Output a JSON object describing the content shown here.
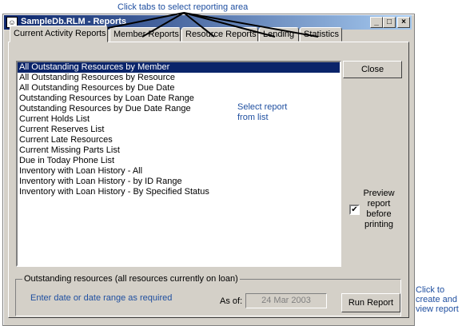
{
  "callouts": {
    "tabs_hint": "Click tabs to select reporting area",
    "run_hint": "Click to create and view report"
  },
  "window": {
    "title": "SampleDb.RLM - Reports",
    "icon": "library-app-icon",
    "controls": {
      "minimize": "_",
      "maximize": "□",
      "close": "×"
    }
  },
  "tabs": [
    {
      "label": "Current Activity Reports",
      "active": true
    },
    {
      "label": "Member Reports",
      "active": false
    },
    {
      "label": "Resource Reports",
      "active": false
    },
    {
      "label": "Lending",
      "active": false
    },
    {
      "label": "Statistics",
      "active": false
    }
  ],
  "report_list": {
    "selected_index": 0,
    "items": [
      "All Outstanding Resources by Member",
      "All Outstanding Resources by Resource",
      "All Outstanding Resources by Due Date",
      "Outstanding Resources by Loan Date Range",
      "Outstanding Resources by Due Date Range",
      "Current Holds List",
      "Current Reserves List",
      "Current Late Resources",
      "Current Missing Parts List",
      "Due in Today Phone List",
      "Inventory with Loan History - All",
      "Inventory with Loan History - by ID Range",
      "Inventory with Loan History - By Specified Status"
    ],
    "hint": "Select report from list"
  },
  "buttons": {
    "close": "Close",
    "run_report": "Run Report"
  },
  "preview": {
    "label": "Preview report before printing",
    "checked": true,
    "check_mark": "✔"
  },
  "options": {
    "group_title": "Outstanding resources (all resources currently on loan)",
    "hint": "Enter date or date range as required",
    "as_of_label": "As of:",
    "as_of_value": "24 Mar 2003"
  },
  "colors": {
    "title_start": "#0a246a",
    "title_end": "#a6caf0",
    "hint_blue": "#1f4fa0",
    "selection": "#0a246a"
  }
}
